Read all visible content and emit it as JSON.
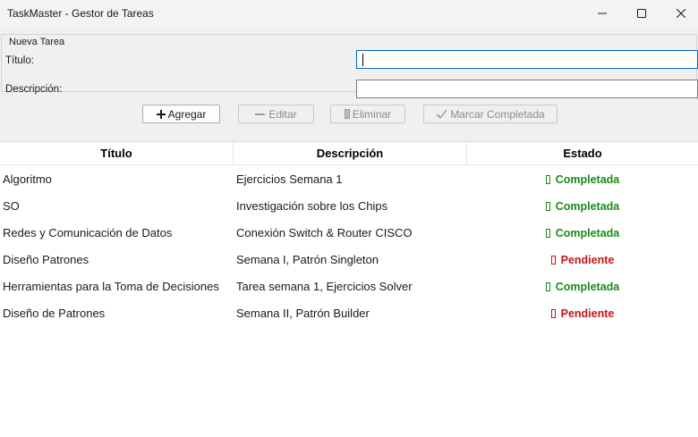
{
  "window": {
    "title": "TaskMaster - Gestor de Tareas",
    "controls": [
      "minimize-icon",
      "maximize-icon",
      "close-icon"
    ]
  },
  "form": {
    "group_title": "Nueva Tarea",
    "titulo_label": "Título:",
    "titulo_value": "",
    "descripcion_label": "Descripción:",
    "descripcion_value": ""
  },
  "toolbar": {
    "agregar": {
      "label": "Agregar",
      "icon": "plus-icon",
      "enabled": true
    },
    "editar": {
      "label": "Editar",
      "icon": "pencil-icon",
      "enabled": false
    },
    "eliminar": {
      "label": "Eliminar",
      "icon": "trash-icon",
      "enabled": false
    },
    "marcar": {
      "label": "Marcar Completada",
      "icon": "checkmark-icon",
      "enabled": false
    }
  },
  "table": {
    "columns": [
      "Título",
      "Descripción",
      "Estado"
    ],
    "rows": [
      {
        "titulo": "Algoritmo",
        "descripcion": "Ejercicios Semana 1",
        "estado": "Completada",
        "status": "done"
      },
      {
        "titulo": "SO",
        "descripcion": "Investigación sobre los Chips",
        "estado": "Completada",
        "status": "done"
      },
      {
        "titulo": "Redes y Comunicación de Datos",
        "descripcion": "Conexión Switch & Router CISCO",
        "estado": "Completada",
        "status": "done"
      },
      {
        "titulo": "Diseño Patrones",
        "descripcion": "Semana I, Patrón Singleton",
        "estado": "Pendiente",
        "status": "pending"
      },
      {
        "titulo": "Herramientas para la Toma de Decisiones",
        "descripcion": "Tarea semana 1, Ejercicios Solver",
        "estado": "Completada",
        "status": "done"
      },
      {
        "titulo": "Diseño de Patrones",
        "descripcion": "Semana II, Patrón Builder",
        "estado": "Pendiente",
        "status": "pending"
      }
    ]
  },
  "colors": {
    "completed": "#1a8a1a",
    "pending": "#c81414",
    "focus_border": "#0067c0"
  }
}
